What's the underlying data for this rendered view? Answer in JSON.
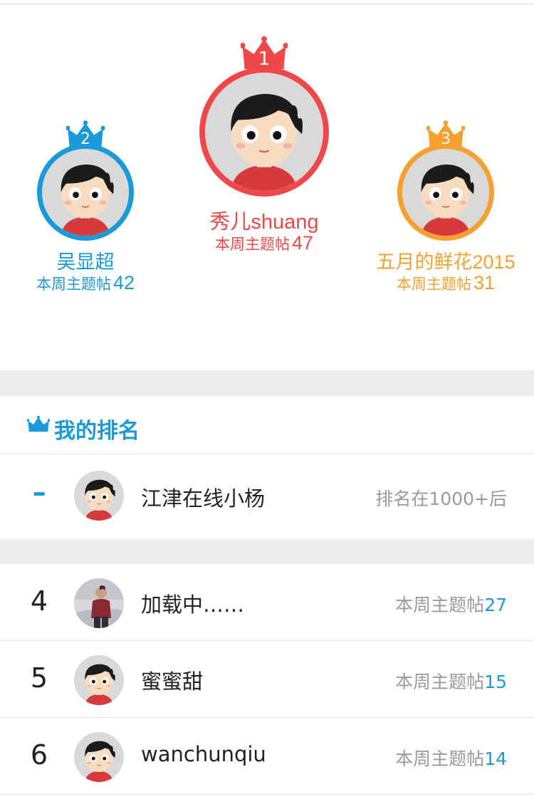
{
  "colors": {
    "first": "#f04848",
    "second": "#1a9ad9",
    "third": "#f5a030",
    "accent": "#1a9ad9",
    "divider": "#ececec"
  },
  "podium": [
    {
      "place": "1",
      "name": "秀儿shuang",
      "stat_label": "本周主题帖",
      "stat_value": "47",
      "icon": "crown-icon"
    },
    {
      "place": "2",
      "name": "吴显超",
      "stat_label": "本周主题帖",
      "stat_value": "42",
      "icon": "crown-icon"
    },
    {
      "place": "3",
      "name": "五月的鲜花2015",
      "stat_label": "本周主题帖",
      "stat_value": "31",
      "icon": "crown-icon"
    }
  ],
  "my_rank": {
    "title": "我的排名",
    "icon": "crown-icon",
    "rank": "–",
    "name": "江津在线小杨",
    "status": "排名在1000+后"
  },
  "list": [
    {
      "rank": "4",
      "name": "加载中……",
      "stat_label": "本周主题帖",
      "stat_value": "27",
      "avatar": "photo"
    },
    {
      "rank": "5",
      "name": "蜜蜜甜",
      "stat_label": "本周主题帖",
      "stat_value": "15",
      "avatar": "cartoon"
    },
    {
      "rank": "6",
      "name": "wanchunqiu",
      "stat_label": "本周主题帖",
      "stat_value": "14",
      "avatar": "cartoon"
    }
  ]
}
